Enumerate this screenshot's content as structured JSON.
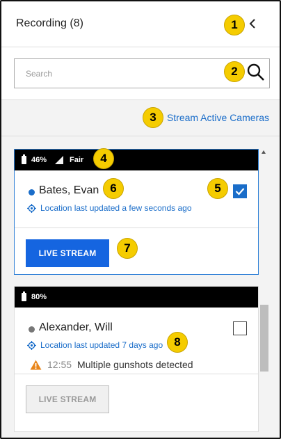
{
  "header": {
    "title": "Recording (8)",
    "collapse_icon": "chevron-left-icon"
  },
  "search": {
    "placeholder": "Search",
    "value": "",
    "icon": "search-icon"
  },
  "stream_link": "Stream Active Cameras",
  "cards": [
    {
      "battery": "46%",
      "signal": "Fair",
      "name": "Bates, Evan",
      "status_color": "#1a6dc9",
      "location": "Location last updated a few seconds ago",
      "checked": true,
      "live_stream": "LIVE STREAM",
      "live_enabled": true
    },
    {
      "battery": "80%",
      "name": "Alexander, Will",
      "status_color": "#777777",
      "location": "Location last updated 7 days ago",
      "checked": false,
      "alert_time": "12:55",
      "alert_text": "Multiple gunshots detected",
      "alert_icon": "warning-icon",
      "live_stream": "LIVE STREAM",
      "live_enabled": false
    }
  ],
  "callouts": [
    "1",
    "2",
    "3",
    "4",
    "5",
    "6",
    "7",
    "8"
  ],
  "colors": {
    "accent": "#1a6dc9",
    "button": "#1565e0",
    "callout": "#f5cc00",
    "warning": "#e8851a"
  }
}
